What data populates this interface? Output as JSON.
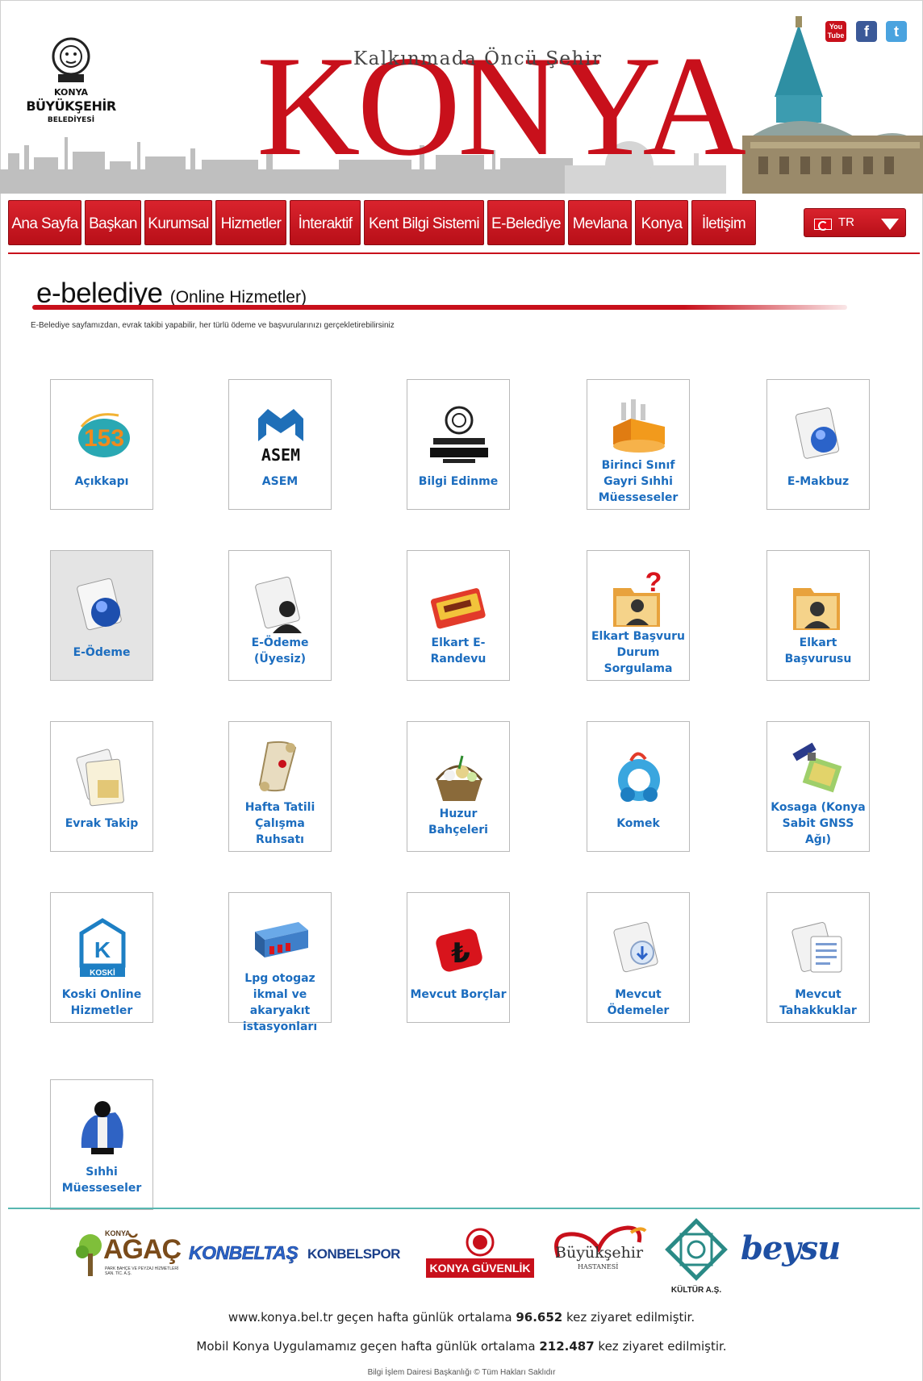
{
  "header": {
    "logo_line1": "KONYA",
    "logo_line2": "BÜYÜKŞEHİR",
    "logo_line3": "BELEDİYESİ",
    "tagline": "Kalkınmada Öncü Şehir",
    "city_name": "KONYA",
    "social": {
      "youtube": "You Tube",
      "facebook": "f",
      "twitter": "t"
    }
  },
  "nav": {
    "items": [
      {
        "label": "Ana Sayfa"
      },
      {
        "label": "Başkan"
      },
      {
        "label": "Kurumsal"
      },
      {
        "label": "Hizmetler"
      },
      {
        "label": "İnteraktif"
      },
      {
        "label": "Kent Bilgi Sistemi"
      },
      {
        "label": "E-Belediye"
      },
      {
        "label": "Mevlana"
      },
      {
        "label": "Konya"
      },
      {
        "label": "İletişim"
      }
    ],
    "language": "TR"
  },
  "page": {
    "title": "e-belediye",
    "title_suffix": "(Online Hizmetler)",
    "subtitle": "E-Belediye sayfamızdan, evrak takibi yapabilir, her türlü ödeme ve başvurularınızı gerçekletirebilirsiniz"
  },
  "services": [
    {
      "label": "Açıkkapı",
      "icon": "acikkapi-153-icon"
    },
    {
      "label": "ASEM",
      "icon": "asem-logo-icon"
    },
    {
      "label": "Bilgi Edinme",
      "icon": "konya-buyuksehir-logo-icon"
    },
    {
      "label": "Birinci Sınıf Gayri Sıhhi Müesseseler",
      "icon": "factory-icon"
    },
    {
      "label": "E-Makbuz",
      "icon": "document-globe-icon"
    },
    {
      "label": "E-Ödeme",
      "icon": "document-globe-icon"
    },
    {
      "label": "E-Ödeme (Üyesiz)",
      "icon": "document-user-icon"
    },
    {
      "label": "Elkart E-Randevu",
      "icon": "elkart-card-icon"
    },
    {
      "label": "Elkart Başvuru Durum Sorgulama",
      "icon": "folder-question-icon"
    },
    {
      "label": "Elkart Başvurusu",
      "icon": "folder-user-icon"
    },
    {
      "label": "Evrak Takip",
      "icon": "document-stack-icon"
    },
    {
      "label": "Hafta Tatili Çalışma Ruhsatı",
      "icon": "scroll-icon"
    },
    {
      "label": "Huzur Bahçeleri",
      "icon": "flower-basket-icon"
    },
    {
      "label": "Komek",
      "icon": "komek-logo-icon"
    },
    {
      "label": "Kosaga (Konya Sabit GNSS Ağı)",
      "icon": "satellite-icon"
    },
    {
      "label": "Koski Online Hizmetler",
      "icon": "koski-logo-icon"
    },
    {
      "label": "Lpg otogaz ikmal ve akaryakıt istasyonları",
      "icon": "gas-station-icon"
    },
    {
      "label": "Mevcut Borçlar",
      "icon": "lira-icon"
    },
    {
      "label": "Mevcut Ödemeler",
      "icon": "document-download-icon"
    },
    {
      "label": "Mevcut Tahakkuklar",
      "icon": "document-list-icon"
    },
    {
      "label": "Sıhhi Müesseseler",
      "icon": "chef-icon"
    }
  ],
  "partners": {
    "agac": "AĞAÇ",
    "agac_sub": "PARK BAHÇE VE PEYZAJ HİZMETLERİ SAN. TİC. A.Ş.",
    "agac_top": "KONYA",
    "konbeltas": "KONBELTAŞ",
    "konbelspor": "KONBELSPOR",
    "konya_guvenlik": "KONYA GÜVENLİK",
    "hastane": "Büyükşehir",
    "hastane_sub": "HASTANESİ",
    "kultur": "KÜLTÜR A.Ş.",
    "beysu": "beysu"
  },
  "footer": {
    "line1_pre": "www.konya.bel.tr geçen hafta günlük ortalama ",
    "line1_num": "96.652",
    "line1_post": " kez ziyaret edilmiştir.",
    "line2_pre": "Mobil Konya Uygulamamız geçen hafta günlük ortalama ",
    "line2_num": "212.487",
    "line2_post": " kez ziyaret edilmiştir.",
    "copyright": "Bilgi İşlem Dairesi Başkanlığı © Tüm Hakları Saklıdır"
  }
}
